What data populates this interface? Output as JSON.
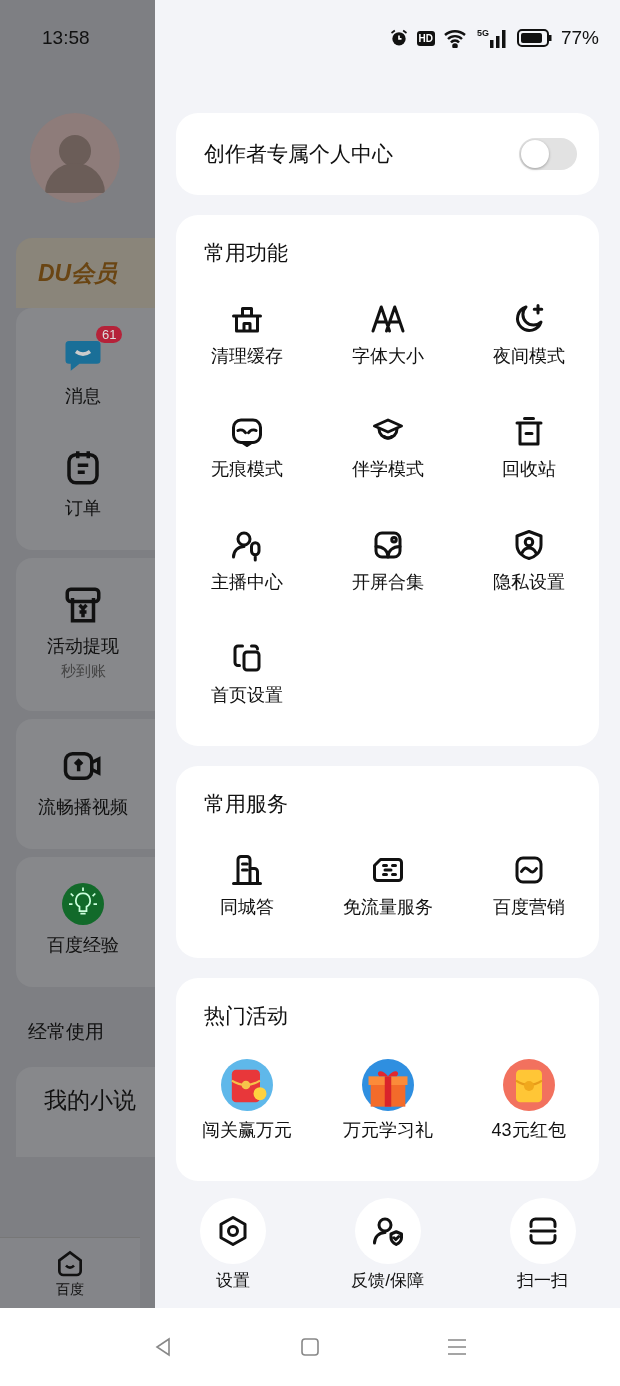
{
  "status_bar": {
    "time": "13:58",
    "hd_badge": "HD",
    "network": "5G",
    "battery": "77%"
  },
  "background_page": {
    "membership": "DU会员",
    "cards": [
      {
        "items": [
          {
            "label": "消息",
            "badge": "61"
          },
          {
            "label": "订单"
          }
        ]
      },
      {
        "items": [
          {
            "label": "活动提现",
            "sublabel": "秒到账"
          }
        ]
      },
      {
        "items": [
          {
            "label": "流畅播视频"
          }
        ]
      },
      {
        "items": [
          {
            "label": "百度经验"
          }
        ]
      }
    ],
    "section_title": "经常使用",
    "novel_card": "我的小说",
    "tab": "百度"
  },
  "drawer": {
    "creator_toggle": {
      "label": "创作者专属个人中心",
      "on": false
    },
    "sections": [
      {
        "title": "常用功能",
        "kind": "tools",
        "items": [
          "清理缓存",
          "字体大小",
          "夜间模式",
          "无痕模式",
          "伴学模式",
          "回收站",
          "主播中心",
          "开屏合集",
          "隐私设置",
          "首页设置"
        ]
      },
      {
        "title": "常用服务",
        "kind": "services",
        "items": [
          "同城答",
          "免流量服务",
          "百度营销"
        ]
      },
      {
        "title": "热门活动",
        "kind": "activities",
        "items": [
          "闯关赢万元",
          "万元学习礼",
          "43元红包"
        ]
      }
    ],
    "bottom_actions": [
      "设置",
      "反馈/保障",
      "扫一扫"
    ]
  }
}
